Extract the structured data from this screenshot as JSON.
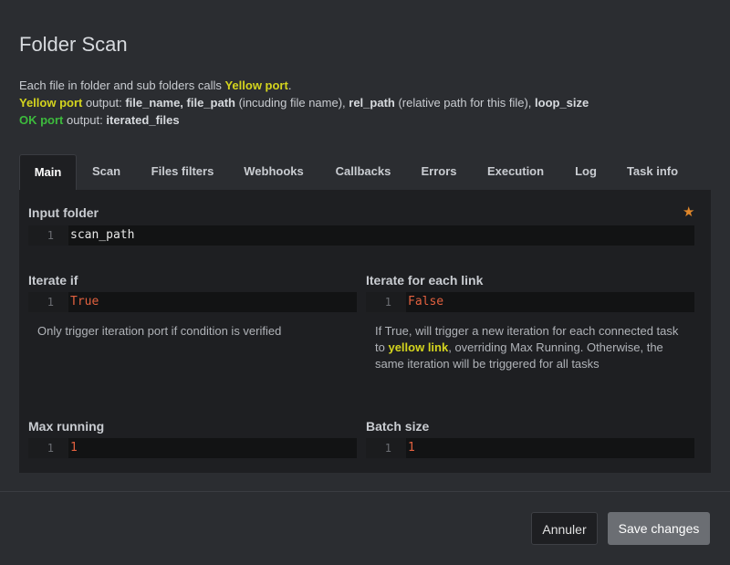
{
  "modal": {
    "title": "Folder Scan",
    "desc": {
      "line1_pre": "Each file in folder and sub folders calls ",
      "line1_port": "Yellow port",
      "line1_post": ".",
      "line2_port": "Yellow port",
      "line2_output": " output: ",
      "line2_file_name": "file_name, file_path",
      "line2_incl": " (incuding file name), ",
      "line2_rel_path": "rel_path",
      "line2_rel_desc": " (relative path for this file), ",
      "line2_loop_size": "loop_size",
      "line3_port": "OK port",
      "line3_output": " output: ",
      "line3_iterated": "iterated_files"
    }
  },
  "tabs": [
    {
      "label": "Main",
      "active": true
    },
    {
      "label": "Scan"
    },
    {
      "label": "Files filters"
    },
    {
      "label": "Webhooks"
    },
    {
      "label": "Callbacks"
    },
    {
      "label": "Errors"
    },
    {
      "label": "Execution"
    },
    {
      "label": "Log"
    },
    {
      "label": "Task info"
    }
  ],
  "main": {
    "input_folder": {
      "label": "Input folder",
      "line": "1",
      "value": "scan_path",
      "star": "★"
    },
    "iterate_if": {
      "label": "Iterate if",
      "line": "1",
      "value": "True",
      "help": "Only trigger iteration port if condition is verified"
    },
    "iterate_each_link": {
      "label": "Iterate for each link",
      "line": "1",
      "value": "False",
      "help_pre": "If True, will trigger a new iteration for each connected task to ",
      "help_link": "yellow link",
      "help_post": ", overriding Max Running. Otherwise, the same iteration will be triggered for all tasks"
    },
    "max_running": {
      "label": "Max running",
      "line": "1",
      "value": "1"
    },
    "batch_size": {
      "label": "Batch size",
      "line": "1",
      "value": "1"
    }
  },
  "footer": {
    "cancel": "Annuler",
    "save": "Save changes"
  },
  "colors": {
    "accent_yellow": "#d4d41e",
    "accent_green": "#3dbb3d",
    "literal": "#e2613f",
    "star": "#e0872a"
  }
}
